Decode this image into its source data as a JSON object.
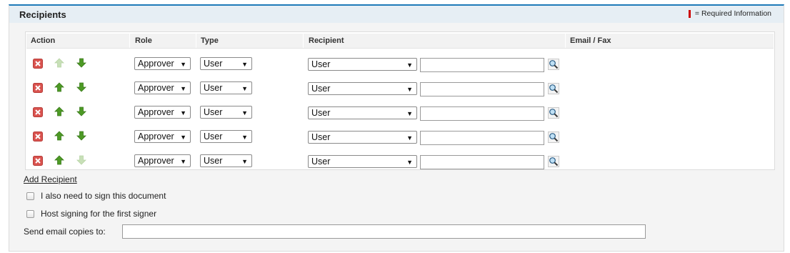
{
  "panel": {
    "title": "Recipients",
    "required_legend": "= Required Information"
  },
  "table": {
    "headers": {
      "action": "Action",
      "role": "Role",
      "type": "Type",
      "recipient": "Recipient",
      "email_fax": "Email / Fax"
    },
    "rows": [
      {
        "role": "Approver",
        "type": "User",
        "recipient_type": "User",
        "recipient_value": "",
        "up_enabled": false,
        "down_enabled": true
      },
      {
        "role": "Approver",
        "type": "User",
        "recipient_type": "User",
        "recipient_value": "",
        "up_enabled": true,
        "down_enabled": true
      },
      {
        "role": "Approver",
        "type": "User",
        "recipient_type": "User",
        "recipient_value": "",
        "up_enabled": true,
        "down_enabled": true
      },
      {
        "role": "Approver",
        "type": "User",
        "recipient_type": "User",
        "recipient_value": "",
        "up_enabled": true,
        "down_enabled": true
      },
      {
        "role": "Approver",
        "type": "User",
        "recipient_type": "User",
        "recipient_value": "",
        "up_enabled": true,
        "down_enabled": false
      }
    ]
  },
  "add_recipient_label": "Add Recipient",
  "options": {
    "sign_label": "I also need to sign this document",
    "sign_checked": false,
    "host_label": "Host signing for the first signer",
    "host_checked": false
  },
  "email_copies": {
    "label": "Send email copies to:",
    "value": ""
  },
  "icons": {
    "remove": "remove-icon",
    "move_up": "arrow-up-icon",
    "move_down": "arrow-down-icon",
    "lookup": "lookup-magnifier-icon"
  },
  "colors": {
    "header_accent": "#1e7ab8",
    "required_marker": "#cc0000",
    "arrow_green": "#4d9a25",
    "arrow_disabled": "#c8e0b8",
    "remove_red": "#d9534f"
  }
}
